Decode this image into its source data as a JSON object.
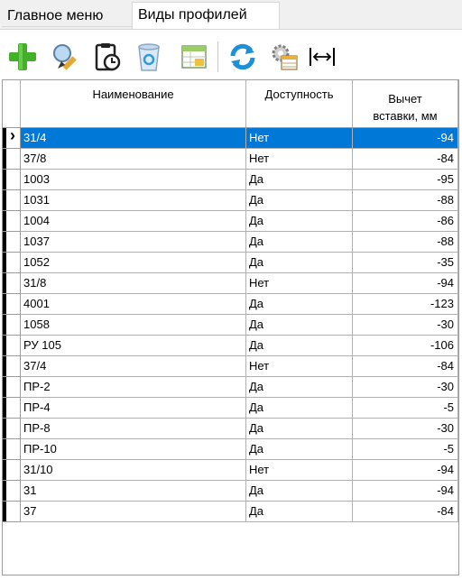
{
  "tabs": [
    "Главное меню",
    "Виды профилей"
  ],
  "toolbar": {
    "icons": [
      "add-icon",
      "edit-icon",
      "history-icon",
      "recycle-bin-icon",
      "spreadsheet-icon",
      "refresh-icon",
      "settings-table-icon",
      "fit-width-icon"
    ]
  },
  "grid": {
    "columns": [
      "Наименование",
      "Доступность",
      "Вычет вставки, мм"
    ],
    "column_lines": [
      "Вычет",
      "вставки, мм"
    ],
    "selected_row": 0,
    "selected_color": "#0078d7",
    "rows": [
      {
        "name": "31/4",
        "avail": "Нет",
        "deduct": "-94"
      },
      {
        "name": "37/8",
        "avail": "Нет",
        "deduct": "-84"
      },
      {
        "name": "1003",
        "avail": "Да",
        "deduct": "-95"
      },
      {
        "name": "1031",
        "avail": "Да",
        "deduct": "-88"
      },
      {
        "name": "1004",
        "avail": "Да",
        "deduct": "-86"
      },
      {
        "name": "1037",
        "avail": "Да",
        "deduct": "-88"
      },
      {
        "name": "1052",
        "avail": "Да",
        "deduct": "-35"
      },
      {
        "name": "31/8",
        "avail": "Нет",
        "deduct": "-94"
      },
      {
        "name": "4001",
        "avail": "Да",
        "deduct": "-123"
      },
      {
        "name": "1058",
        "avail": "Да",
        "deduct": "-30"
      },
      {
        "name": "РУ 105",
        "avail": "Да",
        "deduct": "-106"
      },
      {
        "name": "37/4",
        "avail": "Нет",
        "deduct": "-84"
      },
      {
        "name": "ПР-2",
        "avail": "Да",
        "deduct": "-30"
      },
      {
        "name": "ПР-4",
        "avail": "Да",
        "deduct": "-5"
      },
      {
        "name": "ПР-8",
        "avail": "Да",
        "deduct": "-30"
      },
      {
        "name": "ПР-10",
        "avail": "Да",
        "deduct": "-5"
      },
      {
        "name": "31/10",
        "avail": "Нет",
        "deduct": "-94"
      },
      {
        "name": "31",
        "avail": "Да",
        "deduct": "-94"
      },
      {
        "name": "37",
        "avail": "Да",
        "deduct": "-84"
      }
    ]
  }
}
